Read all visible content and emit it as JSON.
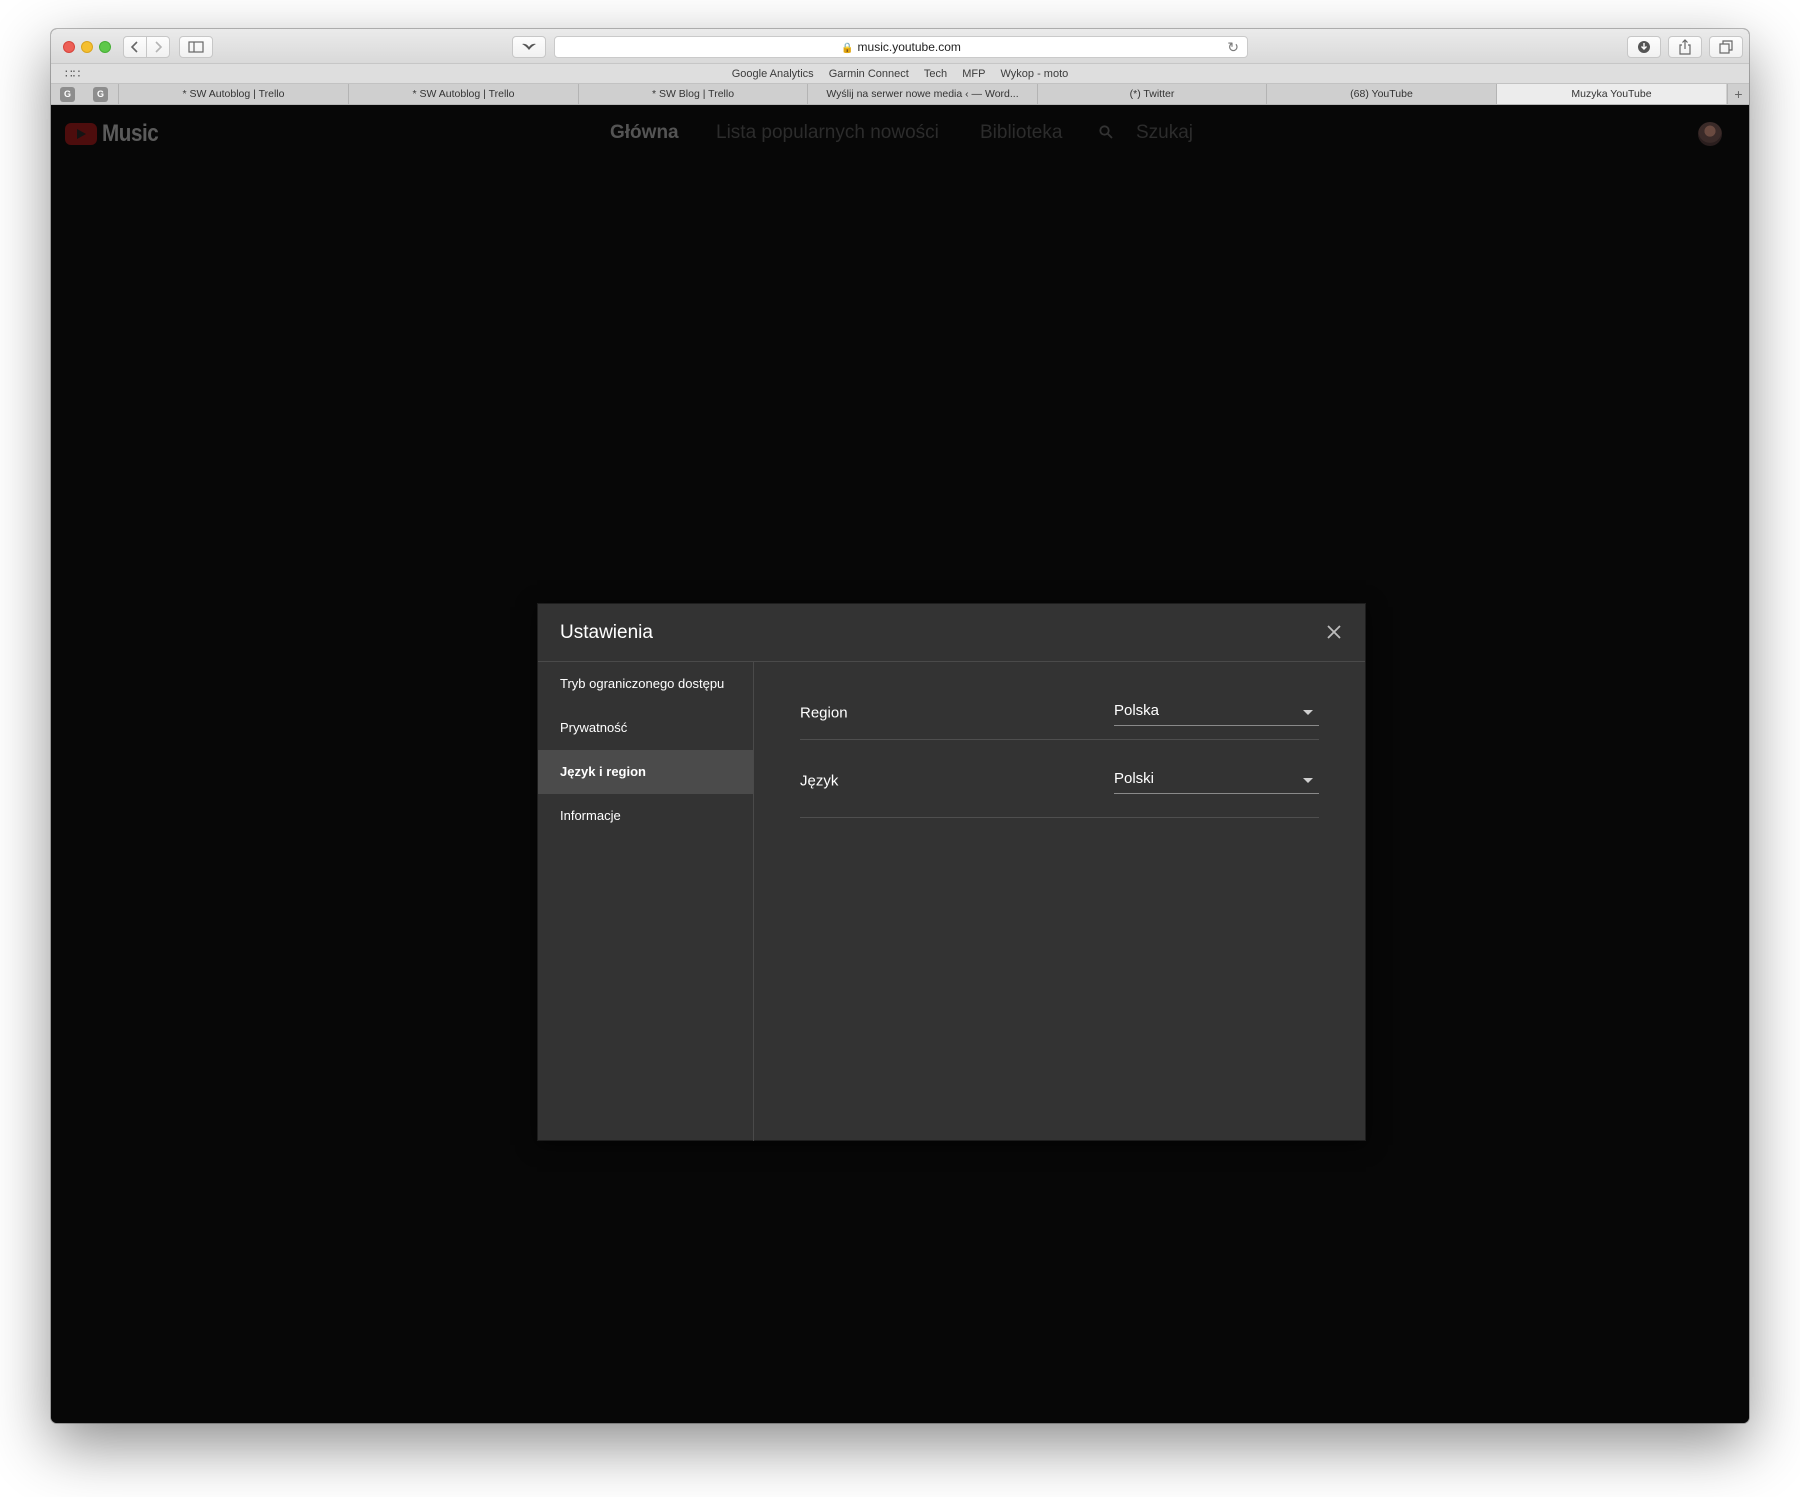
{
  "browser": {
    "url": "music.youtube.com",
    "bookmarks": [
      "Google Analytics",
      "Garmin Connect",
      "Tech",
      "MFP",
      "Wykop - moto"
    ],
    "pinned_tabs": [
      "G",
      "G"
    ],
    "tabs": [
      "* SW Autoblog | Trello",
      "* SW Autoblog | Trello",
      "* SW Blog | Trello",
      "Wyślij na serwer nowe media ‹ — Word...",
      "(*) Twitter",
      "(68) YouTube",
      "Muzyka YouTube"
    ],
    "active_tab": "Muzyka YouTube"
  },
  "header": {
    "logo_text": "Music",
    "nav": {
      "home": "Główna",
      "new_releases": "Lista popularnych nowości",
      "library": "Biblioteka",
      "search": "Szukaj"
    }
  },
  "dialog": {
    "title": "Ustawienia",
    "nav": [
      "Tryb ograniczonego dostępu",
      "Prywatność",
      "Język i region",
      "Informacje"
    ],
    "selected_nav": "Język i region",
    "settings": {
      "region": {
        "label": "Region",
        "value": "Polska"
      },
      "language": {
        "label": "Język",
        "value": "Polski"
      }
    }
  },
  "colors": {
    "dialog_bg": "#333333",
    "selected_nav_bg": "#4b4b4b",
    "page_bg": "#070707",
    "brand_red": "#ff0000"
  },
  "icons": {
    "close": "close-icon",
    "search": "search-icon",
    "dropdown": "caret-down-icon"
  }
}
